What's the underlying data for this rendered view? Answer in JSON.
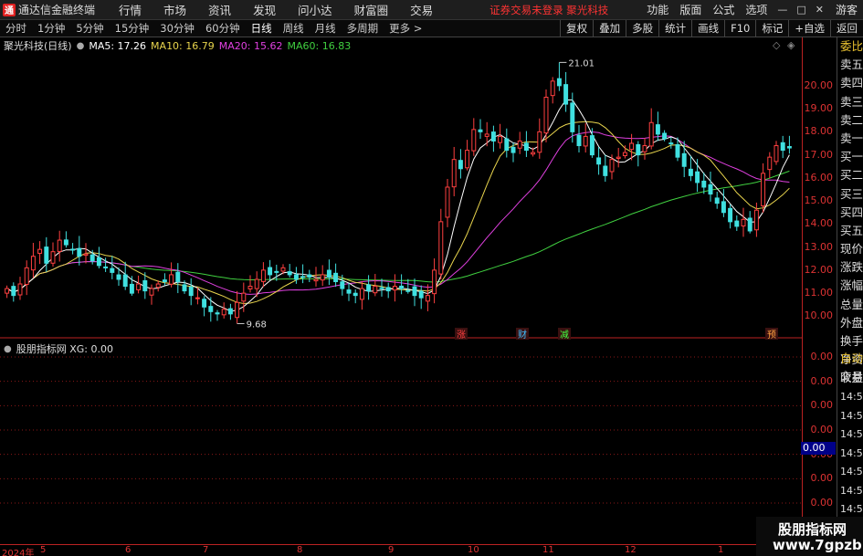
{
  "titlebar": {
    "logo_text": "通",
    "app_title": "通达信金融终端",
    "menus": [
      "行情",
      "市场",
      "资讯",
      "发现",
      "问小达",
      "财富圈",
      "交易"
    ],
    "status": "证券交易未登录 聚光科技",
    "right_menus": [
      "功能",
      "版面",
      "公式",
      "选项"
    ],
    "window_buttons": [
      "—",
      "□",
      "✕"
    ],
    "account": "游客"
  },
  "tabbar": {
    "periods": [
      "分时",
      "1分钟",
      "5分钟",
      "15分钟",
      "30分钟",
      "60分钟",
      "日线",
      "周线",
      "月线",
      "多周期",
      "更多 >"
    ],
    "active_period": "日线",
    "tools": [
      "复权",
      "叠加",
      "多股",
      "统计",
      "画线",
      "F10",
      "标记",
      "+自选",
      "返回"
    ]
  },
  "chart_header": {
    "title": "聚光科技(日线)",
    "ma": [
      {
        "label": "MA5: 17.26",
        "color": "#ffffff"
      },
      {
        "label": "MA10: 16.79",
        "color": "#e8d44d"
      },
      {
        "label": "MA20: 15.62",
        "color": "#e040e0"
      },
      {
        "label": "MA60: 16.83",
        "color": "#40d040"
      }
    ],
    "sub_title": "股朋指标网 XG: 0.00"
  },
  "annotations": {
    "high_label": "21.01",
    "low_label": "9.68",
    "event_markers": [
      {
        "text": "涨",
        "color": "#ff4040"
      },
      {
        "text": "财",
        "color": "#40c0ff"
      },
      {
        "text": "减",
        "color": "#40ff40"
      },
      {
        "text": "预",
        "color": "#ffa040"
      }
    ]
  },
  "price_axis": [
    "20.00",
    "19.00",
    "18.00",
    "17.00",
    "16.00",
    "15.00",
    "14.00",
    "13.00",
    "12.00",
    "11.00",
    "10.00"
  ],
  "sub_axis": [
    "0.00",
    "0.00",
    "0.00",
    "0.00",
    "0.00",
    "0.00",
    "0.00"
  ],
  "sub_current_value": "0.00",
  "side_panel": {
    "labels": [
      "委比",
      "卖五",
      "卖四",
      "卖三",
      "卖二",
      "卖一",
      "买一",
      "买二",
      "买三",
      "买四",
      "买五",
      "现价",
      "涨跌",
      "涨幅",
      "总量",
      "外盘",
      "换手",
      "净资",
      "收益"
    ],
    "lower_labels": [
      "自动",
      "交易"
    ],
    "times": [
      "14:56",
      "14:56",
      "14:56",
      "14:56",
      "14:56",
      "14:56",
      "14:56",
      "14:56"
    ]
  },
  "date_axis": {
    "year_label": "2024年",
    "months": [
      "5",
      "6",
      "7",
      "8",
      "9",
      "10",
      "11",
      "12",
      "1"
    ]
  },
  "watermark": {
    "title": "股朋指标网",
    "url": "www.7gpzb.com"
  },
  "colors": {
    "up": "#ff4040",
    "down": "#40e0e0",
    "ma5": "#ffffff",
    "ma10": "#e8d44d",
    "ma20": "#e040e0",
    "ma60": "#40d040",
    "axis": "#dd3333"
  },
  "chart_data": {
    "type": "candlestick",
    "title": "聚光科技(日线)",
    "period": "daily",
    "ylim": [
      9.5,
      21.5
    ],
    "price_ticks": [
      10,
      11,
      12,
      13,
      14,
      15,
      16,
      17,
      18,
      19,
      20
    ],
    "x_months": [
      "5",
      "6",
      "7",
      "8",
      "9",
      "10",
      "11",
      "12",
      "1"
    ],
    "highest": 21.01,
    "lowest": 9.68,
    "close": [
      11.2,
      10.9,
      11.4,
      12.1,
      12.6,
      12.9,
      12.3,
      12.8,
      13.3,
      13.1,
      12.9,
      12.6,
      12.7,
      12.4,
      12.2,
      12.1,
      11.9,
      11.6,
      11.3,
      11.0,
      11.4,
      11.1,
      11.2,
      11.4,
      11.5,
      11.8,
      11.5,
      11.1,
      10.9,
      10.8,
      10.4,
      10.2,
      10.1,
      10.3,
      10.1,
      10.6,
      11.0,
      11.3,
      11.6,
      12.0,
      11.8,
      11.9,
      12.1,
      11.8,
      11.6,
      11.7,
      11.7,
      11.6,
      11.8,
      11.7,
      11.5,
      11.2,
      11.0,
      10.9,
      11.2,
      11.1,
      11.3,
      11.2,
      11.1,
      11.3,
      11.2,
      11.1,
      10.9,
      10.8,
      10.9,
      12.0,
      14.1,
      15.6,
      16.8,
      16.4,
      17.2,
      18.1,
      18.0,
      17.9,
      17.6,
      17.8,
      17.2,
      17.1,
      17.6,
      17.2,
      17.1,
      18.0,
      19.5,
      20.2,
      20.0,
      19.2,
      18.0,
      17.4,
      17.8,
      17.0,
      16.6,
      16.1,
      16.8,
      16.9,
      17.1,
      17.5,
      17.0,
      17.4,
      18.4,
      17.9,
      17.7,
      17.5,
      16.9,
      16.5,
      16.1,
      15.8,
      15.6,
      15.3,
      14.9,
      14.5,
      14.1,
      13.9,
      14.2,
      13.7,
      14.6,
      16.2,
      16.9,
      17.4,
      17.2,
      17.3
    ],
    "ma5_last": 17.26,
    "ma10_last": 16.79,
    "ma20_last": 15.62,
    "ma60_last": 16.83,
    "sub_indicator": {
      "name": "股朋指标网",
      "label": "XG",
      "value": 0.0
    }
  }
}
